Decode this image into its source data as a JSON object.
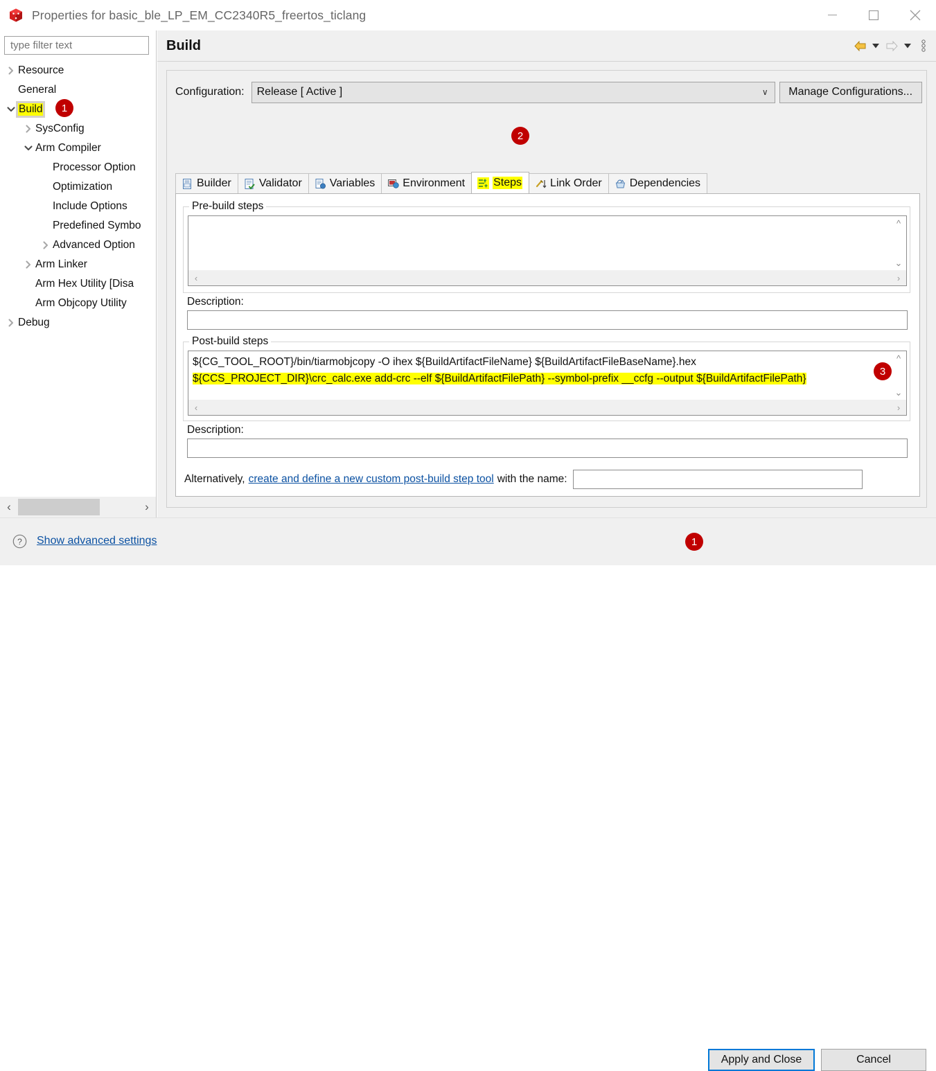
{
  "window": {
    "title": "Properties for basic_ble_LP_EM_CC2340R5_freertos_ticlang",
    "app_icon": "package-cube-icon",
    "minimize": "—",
    "maximize": "□",
    "close": "✕"
  },
  "sidebar": {
    "filter_placeholder": "type filter text",
    "items": [
      {
        "label": "Resource",
        "indent": 0,
        "twisty": "collapsed"
      },
      {
        "label": "General",
        "indent": 0,
        "twisty": "none"
      },
      {
        "label": "Build",
        "indent": 0,
        "twisty": "expanded",
        "highlighted": true
      },
      {
        "label": "SysConfig",
        "indent": 1,
        "twisty": "collapsed"
      },
      {
        "label": "Arm Compiler",
        "indent": 1,
        "twisty": "expanded"
      },
      {
        "label": "Processor Option",
        "indent": 2,
        "twisty": "none"
      },
      {
        "label": "Optimization",
        "indent": 2,
        "twisty": "none"
      },
      {
        "label": "Include Options",
        "indent": 2,
        "twisty": "none"
      },
      {
        "label": "Predefined Symbo",
        "indent": 2,
        "twisty": "none"
      },
      {
        "label": "Advanced Option",
        "indent": 2,
        "twisty": "collapsed"
      },
      {
        "label": "Arm Linker",
        "indent": 1,
        "twisty": "collapsed"
      },
      {
        "label": "Arm Hex Utility  [Disa",
        "indent": 1,
        "twisty": "none"
      },
      {
        "label": "Arm Objcopy Utility",
        "indent": 1,
        "twisty": "none"
      },
      {
        "label": "Debug",
        "indent": 0,
        "twisty": "collapsed"
      }
    ],
    "hscroll": {
      "left_arrow": "‹",
      "right_arrow": "›"
    }
  },
  "page": {
    "title": "Build",
    "tools": [
      {
        "name": "back-arrow-icon",
        "glyph": "⇦"
      },
      {
        "name": "back-dropdown-icon",
        "glyph": "▼"
      },
      {
        "name": "forward-arrow-icon",
        "glyph": "⇨"
      },
      {
        "name": "forward-dropdown-icon",
        "glyph": "▼"
      },
      {
        "name": "view-menu-icon",
        "glyph": "⋮"
      }
    ]
  },
  "configuration": {
    "label": "Configuration:",
    "value": "Release  [ Active ]",
    "chevron": "∨",
    "manage_button": "Manage Configurations..."
  },
  "tabs": [
    {
      "label": "Builder",
      "icon": "builder-icon",
      "selected": false
    },
    {
      "label": "Validator",
      "icon": "validator-icon",
      "selected": false
    },
    {
      "label": "Variables",
      "icon": "variables-icon",
      "selected": false
    },
    {
      "label": "Environment",
      "icon": "environment-icon",
      "selected": false
    },
    {
      "label": "Steps",
      "icon": "steps-icon",
      "selected": true
    },
    {
      "label": "Link Order",
      "icon": "link-order-icon",
      "selected": false
    },
    {
      "label": "Dependencies",
      "icon": "dependencies-icon",
      "selected": false
    }
  ],
  "prebuild": {
    "legend": "Pre-build steps",
    "lines": [],
    "description_label": "Description:",
    "description_value": ""
  },
  "postbuild": {
    "legend": "Post-build steps",
    "lines": [
      {
        "text": "${CG_TOOL_ROOT}/bin/tiarmobjcopy -O ihex ${BuildArtifactFileName} ${BuildArtifactFileBaseName}.hex",
        "highlighted": false
      },
      {
        "text": "${CCS_PROJECT_DIR}\\crc_calc.exe add-crc --elf ${BuildArtifactFilePath} --symbol-prefix __ccfg --output ${BuildArtifactFilePath}",
        "highlighted": true
      }
    ],
    "description_label": "Description:",
    "description_value": ""
  },
  "alternatively": {
    "prefix": "Alternatively,",
    "link": "create and define a new custom post-build step tool",
    "suffix": "with the name:",
    "input_value": ""
  },
  "bottom": {
    "help_icon": "question-mark-icon",
    "advanced_link": "Show advanced settings",
    "apply_button": "Apply and Close",
    "cancel_button": "Cancel"
  },
  "annotations": [
    {
      "number": "1",
      "target": "sidebar-build-item"
    },
    {
      "number": "2",
      "target": "tab-steps"
    },
    {
      "number": "3",
      "target": "postbuild-crc-line"
    },
    {
      "number": "1",
      "target": "apply-and-close-button"
    }
  ],
  "colors": {
    "highlight": "#ffff00",
    "badge": "#c00000",
    "link": "#0b51a2",
    "focus_border": "#0078d7"
  }
}
